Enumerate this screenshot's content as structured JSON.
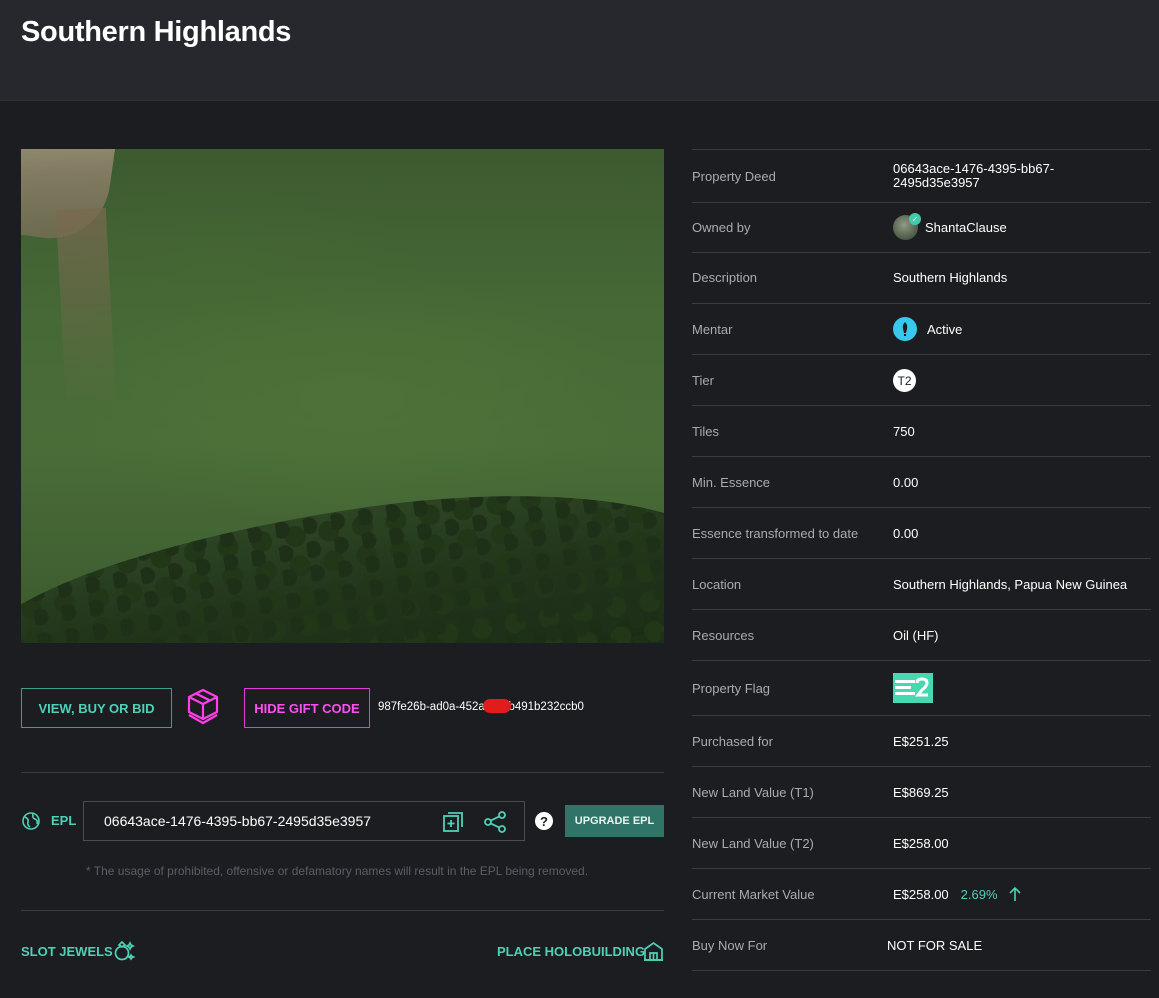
{
  "header": {
    "title": "Southern Highlands"
  },
  "actions": {
    "view_buy_bid": "VIEW, BUY OR BID",
    "hide_gift_code": "HIDE GIFT CODE",
    "gift_code_start": "987fe26b-ad0a-452a-",
    "gift_code_end": "-b491b232ccb0"
  },
  "epl": {
    "label": "EPL",
    "value": "06643ace-1476-4395-bb67-2495d35e3957",
    "help": "?",
    "upgrade": "UPGRADE EPL",
    "note": "* The usage of prohibited, offensive or defamatory names will result in the EPL being removed."
  },
  "links": {
    "slot_jewels": "SLOT JEWELS",
    "place_holobuilding": "PLACE HOLOBUILDING"
  },
  "properties": {
    "deed": {
      "label": "Property Deed",
      "value_line1": "06643ace-1476-4395-bb67-",
      "value_line2": "2495d35e3957"
    },
    "owner": {
      "label": "Owned by",
      "value": "ShantaClause"
    },
    "description": {
      "label": "Description",
      "value": "Southern Highlands"
    },
    "mentar": {
      "label": "Mentar",
      "value": "Active"
    },
    "tier": {
      "label": "Tier",
      "value": "T2"
    },
    "tiles": {
      "label": "Tiles",
      "value": "750"
    },
    "min_essence": {
      "label": "Min. Essence",
      "value": "0.00"
    },
    "essence": {
      "label": "Essence transformed to date",
      "value": "0.00"
    },
    "location": {
      "label": "Location",
      "value": "Southern Highlands, Papua New Guinea"
    },
    "resources": {
      "label": "Resources",
      "value": "Oil (HF)"
    },
    "flag": {
      "label": "Property Flag"
    },
    "purchased": {
      "label": "Purchased for",
      "value": "E$251.25"
    },
    "t1": {
      "label": "New Land Value (T1)",
      "value": "E$869.25"
    },
    "t2": {
      "label": "New Land Value (T2)",
      "value": "E$258.00"
    },
    "market": {
      "label": "Current Market Value",
      "value": "E$258.00",
      "change": "2.69%"
    },
    "buy_now": {
      "label": "Buy Now For",
      "value": "NOT FOR SALE"
    }
  },
  "colors": {
    "accent_teal": "#4fd1b6",
    "accent_pink": "#ff4ff2",
    "redaction": "#e21b1b",
    "flag_green": "#46d8b0"
  }
}
